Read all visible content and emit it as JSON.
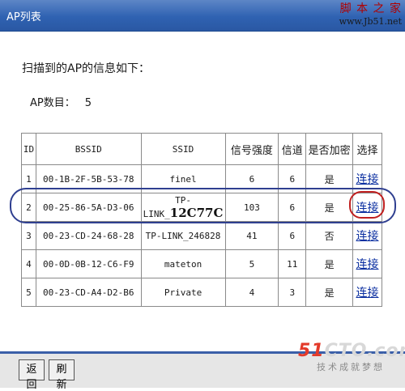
{
  "window": {
    "title": "AP列表"
  },
  "watermark": {
    "line1": "脚 本 之 家",
    "line2": "www.Jb51.net"
  },
  "heading": "扫描到的AP的信息如下：",
  "ap_count": {
    "label": "AP数目：",
    "value": "5"
  },
  "table": {
    "headers": [
      "ID",
      "BSSID",
      "SSID",
      "信号强度",
      "信道",
      "是否加密",
      "选择"
    ],
    "rows": [
      {
        "id": "1",
        "bssid": "00-1B-2F-5B-53-78",
        "ssid": "finel",
        "signal": "6",
        "channel": "6",
        "encrypted": "是",
        "action": "连接"
      },
      {
        "id": "2",
        "bssid": "00-25-86-5A-D3-06",
        "ssid_prefix": "TP-LINK_",
        "ssid_suffix": "12C77C",
        "signal": "103",
        "channel": "6",
        "encrypted": "是",
        "action": "连接"
      },
      {
        "id": "3",
        "bssid": "00-23-CD-24-68-28",
        "ssid": "TP-LINK_246828",
        "signal": "41",
        "channel": "6",
        "encrypted": "否",
        "action": "连接"
      },
      {
        "id": "4",
        "bssid": "00-0D-0B-12-C6-F9",
        "ssid": "mateton",
        "signal": "5",
        "channel": "11",
        "encrypted": "是",
        "action": "连接"
      },
      {
        "id": "5",
        "bssid": "00-23-CD-A4-D2-B6",
        "ssid": "Private",
        "signal": "4",
        "channel": "3",
        "encrypted": "是",
        "action": "连接"
      }
    ]
  },
  "buttons": {
    "back": "返回",
    "refresh": "刷新"
  },
  "brand": {
    "logo_num": "51",
    "logo_rest": "CTO.com",
    "tagline": "技术成就梦想"
  },
  "colors": {
    "titlebar": "#2f62b2",
    "link": "#0a2ea0",
    "highlight_row": "#2f3f90",
    "highlight_link": "#c02020",
    "brand_red": "#e33a2a"
  }
}
